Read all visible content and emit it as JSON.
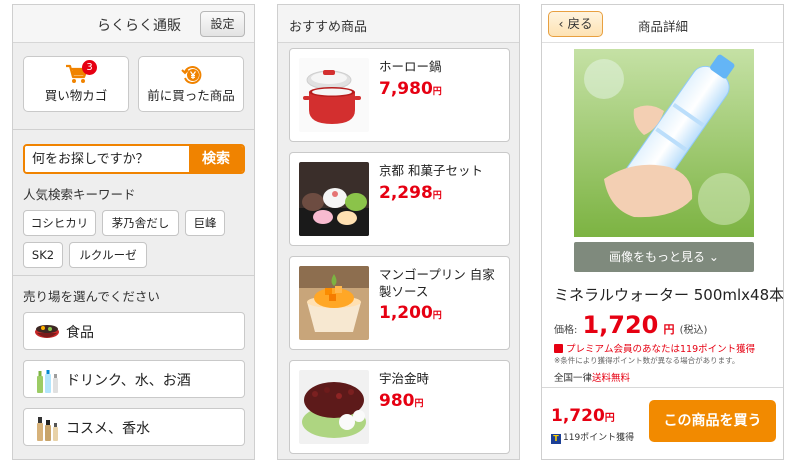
{
  "screen1": {
    "title": "らくらく通販",
    "settings_label": "設定",
    "cart_label": "買い物カゴ",
    "cart_count": "3",
    "prev_purchased_label": "前に買った商品",
    "search_placeholder": "何をお探しですか？",
    "search_button": "検索",
    "popular_keywords_title": "人気検索キーワード",
    "keywords": [
      "コシヒカリ",
      "茅乃舎だし",
      "巨峰",
      "SK2",
      "ルクルーゼ"
    ],
    "categories_title": "売り場を選んでください",
    "categories": [
      "食品",
      "ドリンク、水、お酒",
      "コスメ、香水"
    ]
  },
  "screen2": {
    "title": "おすすめ商品",
    "products": [
      {
        "name": "ホーロー鍋",
        "price": "7,980",
        "unit": "円"
      },
      {
        "name": "京都 和菓子セット",
        "price": "2,298",
        "unit": "円"
      },
      {
        "name": "マンゴープリン 自家製ソース",
        "price": "1,200",
        "unit": "円"
      },
      {
        "name": "宇治金時",
        "price": "980",
        "unit": "円"
      }
    ]
  },
  "screen3": {
    "back_label": "戻る",
    "title": "商品詳細",
    "more_images_label": "画像をもっと見る",
    "product_name": "ミネラルウォーター 500mlx48本",
    "price_label": "価格:",
    "price": "1,720",
    "price_unit": "円",
    "tax_note": "(税込)",
    "premium_note": "プレミアム会員のあなたは119ポイント獲得",
    "conditions_note": "※条件により獲得ポイント数が異なる場合があります。",
    "shipping_prefix": "全国一律",
    "shipping_free": "送料無料",
    "bottom_price": "1,720",
    "bottom_price_unit": "円",
    "bottom_points": "119ポイント獲得",
    "buy_button": "この商品を買う"
  },
  "colors": {
    "accent_orange": "#f08300",
    "price_red": "#e60012",
    "badge_red": "#e60012"
  }
}
